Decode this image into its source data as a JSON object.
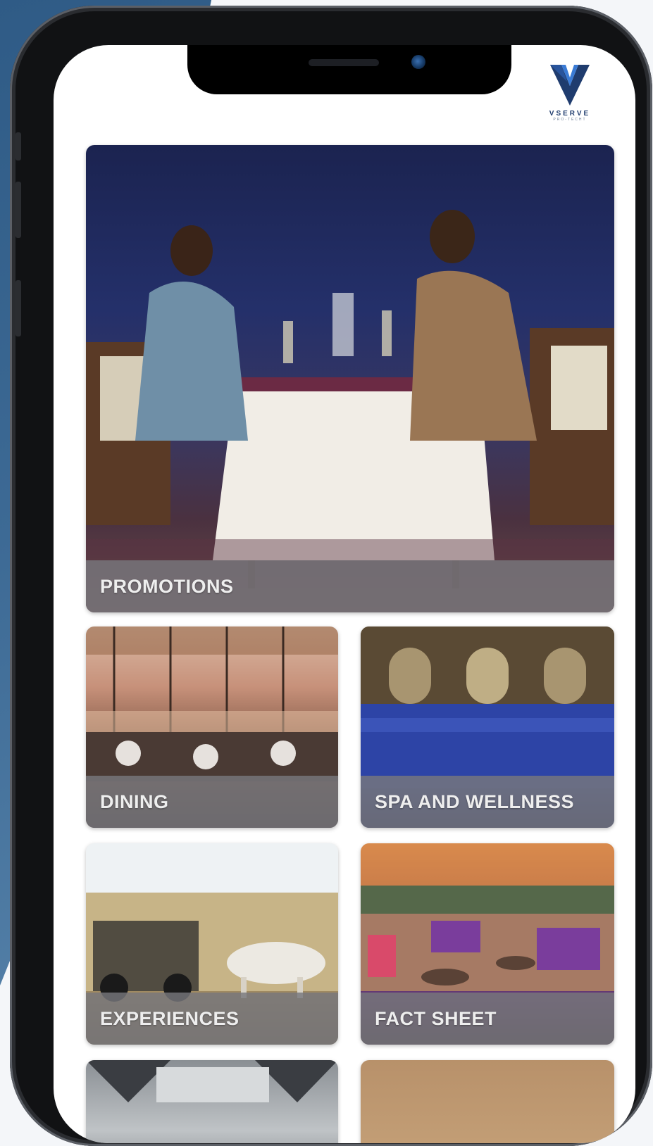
{
  "logo": {
    "brand": "VSERVE",
    "sub": "PRO-TECHT",
    "colors": {
      "primary": "#1f3c6e",
      "accent": "#3a7bd5"
    }
  },
  "tiles": [
    {
      "id": "promotions",
      "label": "PROMOTIONS"
    },
    {
      "id": "dining",
      "label": "DINING"
    },
    {
      "id": "spa",
      "label": "SPA AND WELLNESS"
    },
    {
      "id": "experiences",
      "label": "EXPERIENCES"
    },
    {
      "id": "factsheet",
      "label": "FACT SHEET"
    }
  ],
  "device": {
    "frame_color": "#111214",
    "background_accent": "#2f5b86"
  }
}
